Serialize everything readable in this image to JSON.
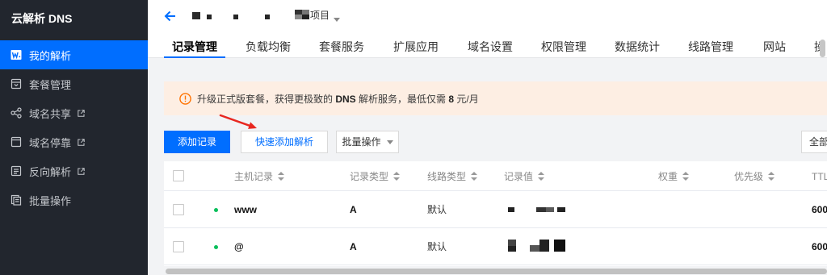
{
  "app": {
    "title": "云解析 DNS"
  },
  "colors": {
    "accent": "#006eff",
    "sidebar_bg": "#22262e",
    "notice_bg": "#fdeee3",
    "warning": "#ff7200",
    "status_enabled": "#0abf5b",
    "annotation_arrow": "#e8271f"
  },
  "sidebar": {
    "external_icon": "external-link-icon",
    "items": [
      {
        "label": "我的解析",
        "icon": "record-list-icon",
        "active": true,
        "external": false
      },
      {
        "label": "套餐管理",
        "icon": "package-icon",
        "active": false,
        "external": false
      },
      {
        "label": "域名共享",
        "icon": "share-icon",
        "active": false,
        "external": true
      },
      {
        "label": "域名停靠",
        "icon": "parking-icon",
        "active": false,
        "external": true
      },
      {
        "label": "反向解析",
        "icon": "reverse-resolve-icon",
        "active": false,
        "external": true
      },
      {
        "label": "批量操作",
        "icon": "batch-icon",
        "active": false,
        "external": false
      }
    ]
  },
  "header": {
    "back_icon": "arrow-left-icon",
    "project_label": "项目",
    "project_dropdown_icon": "caret-down-icon"
  },
  "tabs": [
    {
      "label": "记录管理",
      "active": true
    },
    {
      "label": "负载均衡"
    },
    {
      "label": "套餐服务"
    },
    {
      "label": "扩展应用"
    },
    {
      "label": "域名设置"
    },
    {
      "label": "权限管理"
    },
    {
      "label": "数据统计"
    },
    {
      "label": "线路管理"
    },
    {
      "label": "网站"
    },
    {
      "label": "操"
    }
  ],
  "notice": {
    "icon": "warning-circle-icon",
    "text_before": "升级正式版套餐，获得更极致的 ",
    "highlight_service": "DNS",
    "text_middle": " 解析服务，最低仅需 ",
    "highlight_price": "8",
    "text_after": " 元/月"
  },
  "toolbar": {
    "add_record": "添加记录",
    "quick_add": "快速添加解析",
    "batch": "批量操作",
    "batch_icon": "caret-down-icon",
    "filter": "全部"
  },
  "table": {
    "sort_icon": "sort-icon",
    "columns": [
      {
        "label": "主机记录",
        "sortable": true
      },
      {
        "label": "记录类型",
        "sortable": true
      },
      {
        "label": "线路类型",
        "sortable": true
      },
      {
        "label": "记录值",
        "sortable": true
      },
      {
        "label": "权重",
        "sortable": true
      },
      {
        "label": "优先级",
        "sortable": true
      },
      {
        "label": "TTL"
      }
    ],
    "rows": [
      {
        "host": "www",
        "type": "A",
        "line": "默认",
        "ttl": "600"
      },
      {
        "host": "@",
        "type": "A",
        "line": "默认",
        "ttl": "600"
      }
    ]
  }
}
